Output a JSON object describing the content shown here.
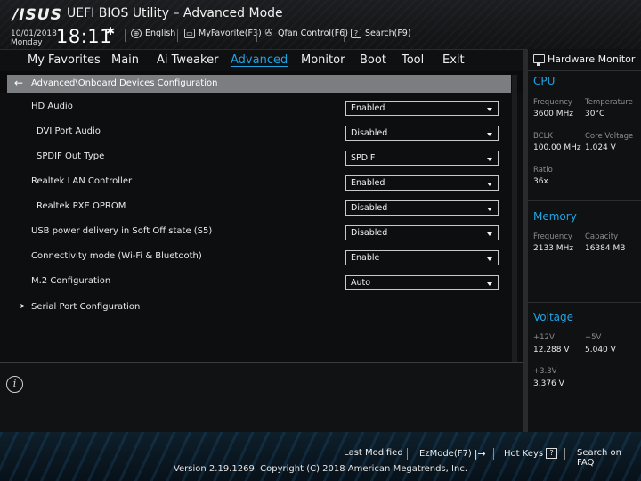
{
  "header": {
    "logo": "/ISUS",
    "title": "UEFI BIOS Utility – Advanced Mode",
    "date": "10/01/2018",
    "day": "Monday",
    "time": "18:11",
    "toolbar": {
      "language": "English",
      "myfavorite": "MyFavorite(F3)",
      "qfan": "Qfan Control(F6)",
      "search": "Search(F9)"
    }
  },
  "menu": {
    "items": [
      {
        "label": "My Favorites"
      },
      {
        "label": "Main"
      },
      {
        "label": "Ai Tweaker"
      },
      {
        "label": "Advanced"
      },
      {
        "label": "Monitor"
      },
      {
        "label": "Boot"
      },
      {
        "label": "Tool"
      },
      {
        "label": "Exit"
      }
    ],
    "active": "Advanced"
  },
  "breadcrumb": "Advanced\\Onboard Devices Configuration",
  "settings": [
    {
      "label": "HD Audio",
      "value": "Enabled"
    },
    {
      "label": "DVI Port Audio",
      "value": "Disabled"
    },
    {
      "label": "SPDIF Out Type",
      "value": "SPDIF"
    },
    {
      "label": "Realtek LAN Controller",
      "value": "Enabled"
    },
    {
      "label": "Realtek PXE OPROM",
      "value": "Disabled"
    },
    {
      "label": "USB power delivery in Soft Off state (S5)",
      "value": "Disabled"
    },
    {
      "label": "Connectivity mode (Wi-Fi & Bluetooth)",
      "value": "Enable"
    },
    {
      "label": "M.2 Configuration",
      "value": "Auto"
    }
  ],
  "submenu": {
    "label": "Serial Port Configuration"
  },
  "hardware_monitor": {
    "title": "Hardware Monitor",
    "cpu": {
      "heading": "CPU",
      "frequency_label": "Frequency",
      "frequency": "3600 MHz",
      "temperature_label": "Temperature",
      "temperature": "30°C",
      "bclk_label": "BCLK",
      "bclk": "100.00 MHz",
      "core_voltage_label": "Core Voltage",
      "core_voltage": "1.024 V",
      "ratio_label": "Ratio",
      "ratio": "36x"
    },
    "memory": {
      "heading": "Memory",
      "frequency_label": "Frequency",
      "frequency": "2133 MHz",
      "capacity_label": "Capacity",
      "capacity": "16384 MB"
    },
    "voltage": {
      "heading": "Voltage",
      "v12_label": "+12V",
      "v12": "12.288 V",
      "v5_label": "+5V",
      "v5": "5.040 V",
      "v33_label": "+3.3V",
      "v33": "3.376 V"
    }
  },
  "footer": {
    "last_modified": "Last Modified",
    "ezmode": "EzMode(F7)",
    "hotkeys": "Hot Keys",
    "hotkeys_key": "?",
    "search_faq": "Search on FAQ",
    "copyright": "Version 2.19.1269. Copyright (C) 2018 American Megatrends, Inc."
  },
  "colors": {
    "accent": "#1fa4e3",
    "breadcrumb_bg": "#7b7d80"
  }
}
